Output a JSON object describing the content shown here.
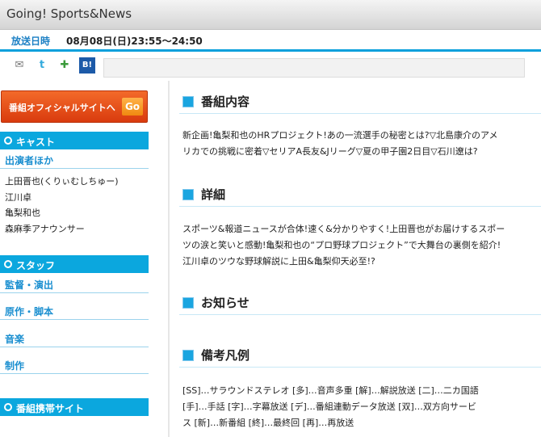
{
  "title": "Going!  Sports&News",
  "air": {
    "label": "放送日時",
    "value": "08月08日(日)23:55～24:50"
  },
  "share": {
    "icons": [
      "mail-icon",
      "twitter-icon",
      "google-icon",
      "hatena-bookmark-icon"
    ],
    "glyphs": [
      "✉",
      "t",
      "✚",
      "B!"
    ]
  },
  "sidebar": {
    "official_label": "番組オフィシャルサイトへ",
    "go_label": "Go",
    "cast_header": "キャスト",
    "cast_sub": "出演者ほか",
    "cast_list": [
      "上田晋也(くりぃむしちゅー)",
      "江川卓",
      "亀梨和也",
      "森麻季アナウンサー"
    ],
    "staff_header": "スタッフ",
    "staff_items": [
      "監督・演出",
      "原作・脚本",
      "音楽",
      "制作"
    ],
    "mobile_header": "番組携帯サイト"
  },
  "main": {
    "content_heading": "番組内容",
    "content_lines": [
      "新企画!亀梨和也のHRプロジェクト!あの一流選手の秘密とは?▽北島康介のアメ",
      "リカでの挑戦に密着▽セリアA長友&Jリーグ▽夏の甲子園2日目▽石川遼は?"
    ],
    "detail_heading": "詳細",
    "detail_lines": [
      "スポーツ&報道ニュースが合体!速く&分かりやすく!上田晋也がお届けするスポー",
      "ツの涙と笑いと感動!亀梨和也の“プロ野球プロジェクト”で大舞台の裏側を紹介!",
      "江川卓のツウな野球解説に上田&亀梨仰天必至!?"
    ],
    "notice_heading": "お知らせ",
    "legend_heading": "備考凡例",
    "legend_lines": [
      "[SS]…サラウンドステレオ  [多]…音声多重  [解]…解説放送  [二]…二カ国語",
      "[手]…手話  [字]…字幕放送  [デ]…番組連動データ放送  [双]…双方向サービ",
      "ス  [新]…新番組  [終]…最終回  [再]…再放送"
    ]
  },
  "colors": {
    "accent": "#0ba7de",
    "link": "#1b8fd0",
    "orange": "#e24c14"
  }
}
